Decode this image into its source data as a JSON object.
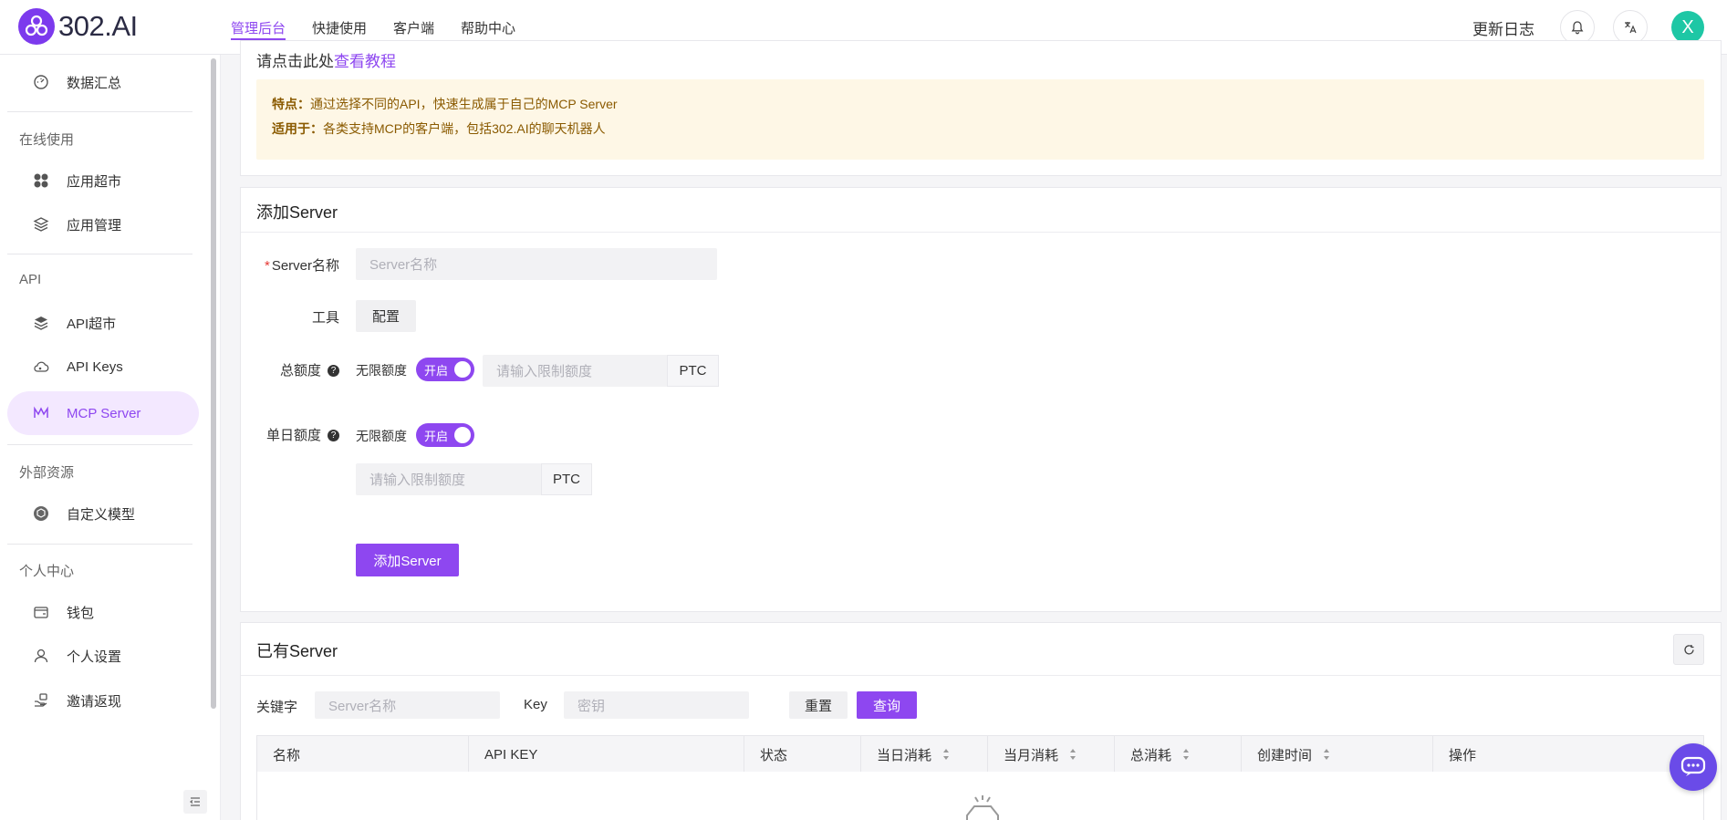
{
  "brand": {
    "name": "302.AI",
    "accent": "#8e47f0"
  },
  "topnav": [
    {
      "label": "管理后台",
      "active": true
    },
    {
      "label": "快捷使用",
      "active": false
    },
    {
      "label": "客户端",
      "active": false
    },
    {
      "label": "帮助中心",
      "active": false
    }
  ],
  "header": {
    "changelog": "更新日志",
    "avatar_letter": "X",
    "bell_icon": "bell-icon",
    "translate_icon": "translate-icon"
  },
  "sidebar": {
    "dashboard": "数据汇总",
    "groups": {
      "online": "在线使用",
      "api": "API",
      "external": "外部资源",
      "personal": "个人中心"
    },
    "items": {
      "app_market": "应用超市",
      "app_manage": "应用管理",
      "api_market": "API超市",
      "api_keys": "API Keys",
      "mcp_server": "MCP Server",
      "custom_model": "自定义模型",
      "wallet": "钱包",
      "settings": "个人设置",
      "invite": "邀请返现"
    }
  },
  "intro": {
    "tutorial_prefix": "请点击此处",
    "tutorial_link": "查看教程",
    "feature_label": "特点：",
    "feature_text": "通过选择不同的API，快速生成属于自己的MCP Server",
    "applies_label": "适用于：",
    "applies_text": "各类支持MCP的客户端，包括302.AI的聊天机器人"
  },
  "add_server": {
    "title": "添加Server",
    "name_label": "Server名称",
    "name_placeholder": "Server名称",
    "tools_label": "工具",
    "configure_button": "配置",
    "total_quota_label": "总额度",
    "daily_quota_label": "单日额度",
    "unlimited_label": "无限额度",
    "toggle_on": "开启",
    "limit_placeholder": "请输入限制额度",
    "unit": "PTC",
    "submit_button": "添加Server"
  },
  "existing": {
    "title": "已有Server",
    "keyword_label": "关键字",
    "keyword_placeholder": "Server名称",
    "key_label": "Key",
    "key_placeholder": "密钥",
    "reset_button": "重置",
    "query_button": "查询",
    "columns": [
      "名称",
      "API KEY",
      "状态",
      "当日消耗",
      "当月消耗",
      "总消耗",
      "创建时间",
      "操作"
    ]
  }
}
